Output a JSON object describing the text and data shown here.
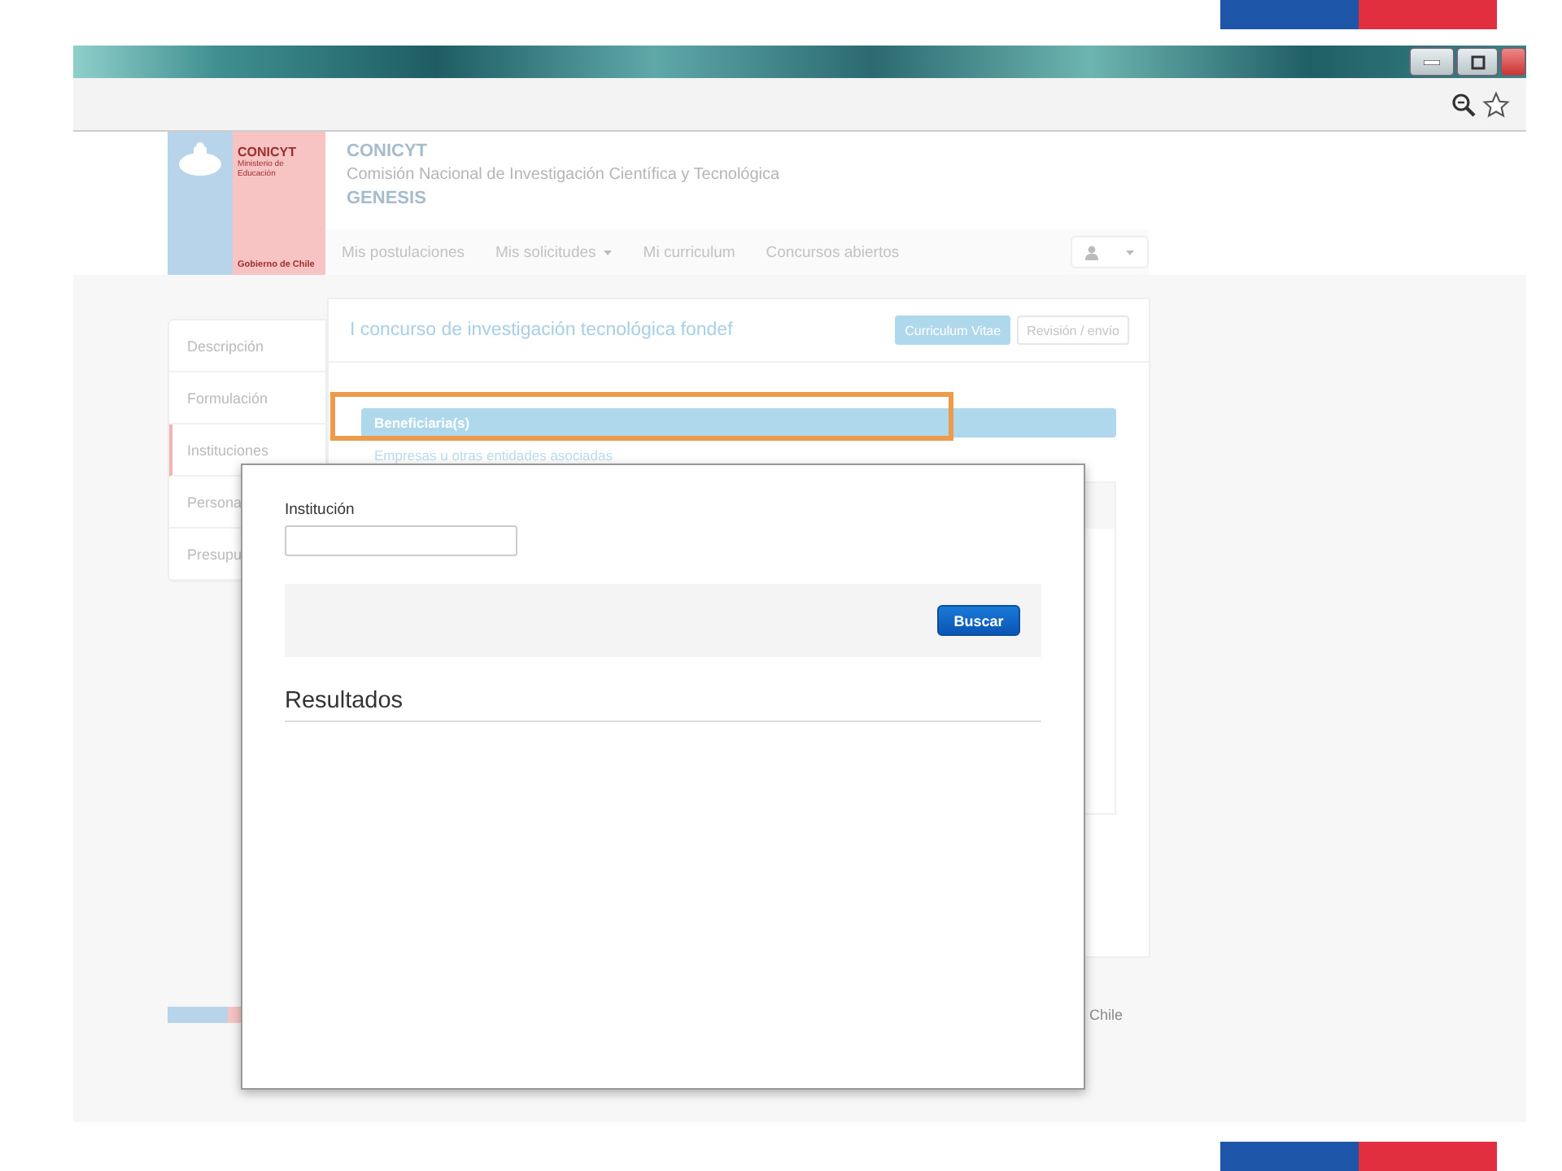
{
  "header": {
    "logo_org": "CONICYT",
    "logo_ministry": "Ministerio de Educación",
    "logo_government": "Gobierno de Chile",
    "org": "CONICYT",
    "subtitle": "Comisión Nacional de Investigación Científica y Tecnológica",
    "app": "GENESIS"
  },
  "nav": [
    {
      "label": "Mis postulaciones",
      "dropdown": false
    },
    {
      "label": "Mis solicitudes",
      "dropdown": true
    },
    {
      "label": "Mi curriculum",
      "dropdown": false
    },
    {
      "label": "Concursos abiertos",
      "dropdown": false
    }
  ],
  "sidebar": [
    {
      "label": "Descripción",
      "selected": false
    },
    {
      "label": "Formulación",
      "selected": false
    },
    {
      "label": "Instituciones",
      "selected": true
    },
    {
      "label": "Persona",
      "selected": false
    },
    {
      "label": "Presupu",
      "selected": false
    }
  ],
  "card": {
    "title": "I concurso de investigación tecnológica fondef",
    "buttons": [
      {
        "label": "Curriculum Vitae",
        "selected": true
      },
      {
        "label": "Revisión / envío",
        "selected": false
      }
    ],
    "section": "Beneficiaria(s)",
    "section_highlighted": true,
    "subsection": "Empresas u otras entidades asociadas"
  },
  "footer": {
    "text": "Chile"
  },
  "modal": {
    "field_label": "Institución",
    "button": "Buscar",
    "results_heading": "Resultados"
  }
}
